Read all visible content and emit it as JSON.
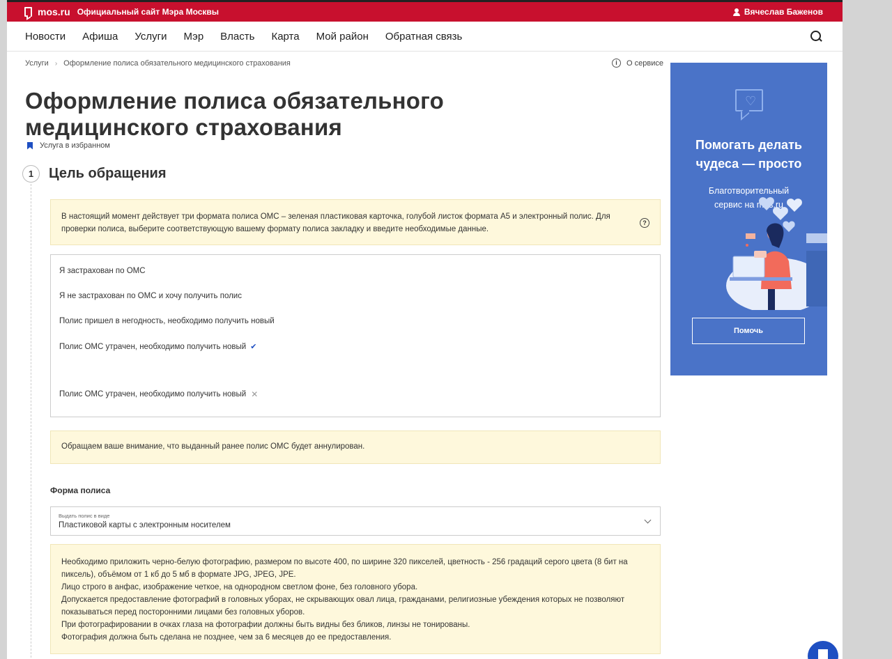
{
  "topbar": {
    "site_name": "mos.ru",
    "site_subtitle": "Официальный сайт Мэра Москвы",
    "user_name": "Вячеслав Баженов",
    "bg_color": "#c8102e"
  },
  "nav": {
    "items": [
      "Новости",
      "Афиша",
      "Услуги",
      "Мэр",
      "Власть",
      "Карта",
      "Мой район",
      "Обратная связь"
    ]
  },
  "breadcrumb": {
    "items": [
      "Услуги",
      "Оформление полиса обязательного медицинского страхования"
    ]
  },
  "about_service": "О сервисе",
  "page_title_line1": "Оформление полиса обязательного",
  "page_title_line2": "медицинского страхования",
  "favorite_label": "Услуга в избранном",
  "step": {
    "number": "1",
    "title": "Цель обращения"
  },
  "info_text": "В настоящий момент действует три формата полиса ОМС – зеленая пластиковая карточка, голубой листок формата А5 и электронный полис. Для проверки полиса, выберите соответствующую вашему формату полиса закладку и введите необходимые данные.",
  "options": [
    {
      "label": "Я застрахован по ОМС"
    },
    {
      "label": "Я не застрахован по ОМС и хочу получить полис"
    },
    {
      "label": "Полис пришел в негодность, необходимо получить новый"
    },
    {
      "label": "Полис ОМС утрачен, необходимо получить новый",
      "state": "selected"
    },
    {
      "label": "Полис ОМС утрачен, необходимо получить новый",
      "state": "removable"
    }
  ],
  "warning_text": "Обращаем ваше внимание, что выданный ранее полис ОМС будет аннулирован.",
  "form": {
    "section_label": "Форма полиса",
    "select_caption": "Выдать полис в виде",
    "select_value": "Пластиковой карты с электронным носителем"
  },
  "photo_requirements": [
    "Необходимо приложить черно-белую фотографию, размером по высоте 400, по ширине 320 пикселей, цветность - 256 градаций серого цвета (8 бит на",
    "пиксель), объёмом от 1 кб до 5 мб в формате JPG, JPEG, JPE.",
    "Лицо строго в анфас, изображение четкое, на однородном светлом фоне, без головного убора.",
    "Допускается предоставление фотографий в головных уборах, не скрывающих овал лица, гражданами, религиозные убеждения которых не позволяют",
    "показываться перед посторонними лицами без головных уборов.",
    "При фотографировании в очках глаза на фотографии должны быть видны без бликов, линзы не тонированы.",
    "Фотография должна быть сделана не позднее, чем за 6 месяцев до ее предоставления."
  ],
  "banner": {
    "headline_line1": "Помогать делать",
    "headline_line2": "чудеса — просто",
    "sub_line1": "Благотворительный",
    "sub_line2": "сервис на mos.ru",
    "button_label": "Помочь",
    "bg_color": "#4a73c8"
  },
  "accent_color": "#1e4fc2"
}
